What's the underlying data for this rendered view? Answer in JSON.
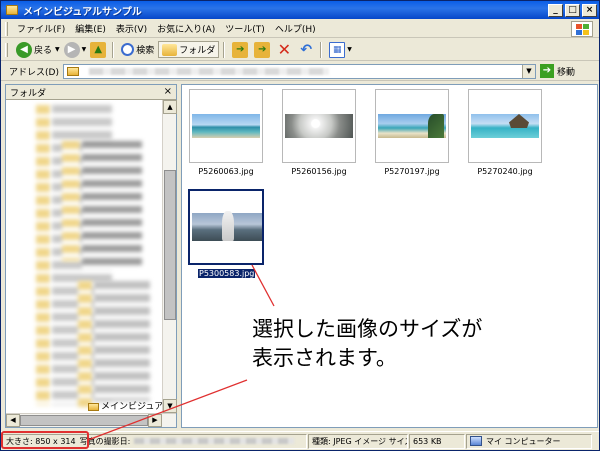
{
  "window": {
    "title": "メインビジュアルサンプル",
    "buttons": [
      "_",
      "□",
      "×"
    ]
  },
  "menu": {
    "items": [
      "ファイル(F)",
      "編集(E)",
      "表示(V)",
      "お気に入り(A)",
      "ツール(T)",
      "ヘルプ(H)"
    ]
  },
  "toolbar": {
    "back_label": "戻る",
    "search_label": "検索",
    "folders_label": "フォルダ"
  },
  "address": {
    "label": "アドレス(D)",
    "go_label": "移動"
  },
  "folder_pane": {
    "title": "フォルダ",
    "close": "×",
    "last_item": "メインビジュアルサ"
  },
  "files": [
    {
      "name": "P5260063.jpg",
      "selected": false
    },
    {
      "name": "P5260156.jpg",
      "selected": false
    },
    {
      "name": "P5270197.jpg",
      "selected": false
    },
    {
      "name": "P5270240.jpg",
      "selected": false
    },
    {
      "name": "P5300583.jpg",
      "selected": true
    }
  ],
  "annotation": {
    "line1": "選択した画像のサイズが",
    "line2": "表示されます。"
  },
  "statusbar": {
    "size_text": "大きさ: 850 x 314",
    "date_label": "写真の撮影日:",
    "type_text": "種類: JPEG イメージ サイズ",
    "file_size": "653 KB",
    "location": "マイ コンピューター"
  },
  "colors": {
    "title_blue": "#0a5ee7",
    "selection_navy": "#0a246a",
    "annotation_red": "#e03030"
  }
}
